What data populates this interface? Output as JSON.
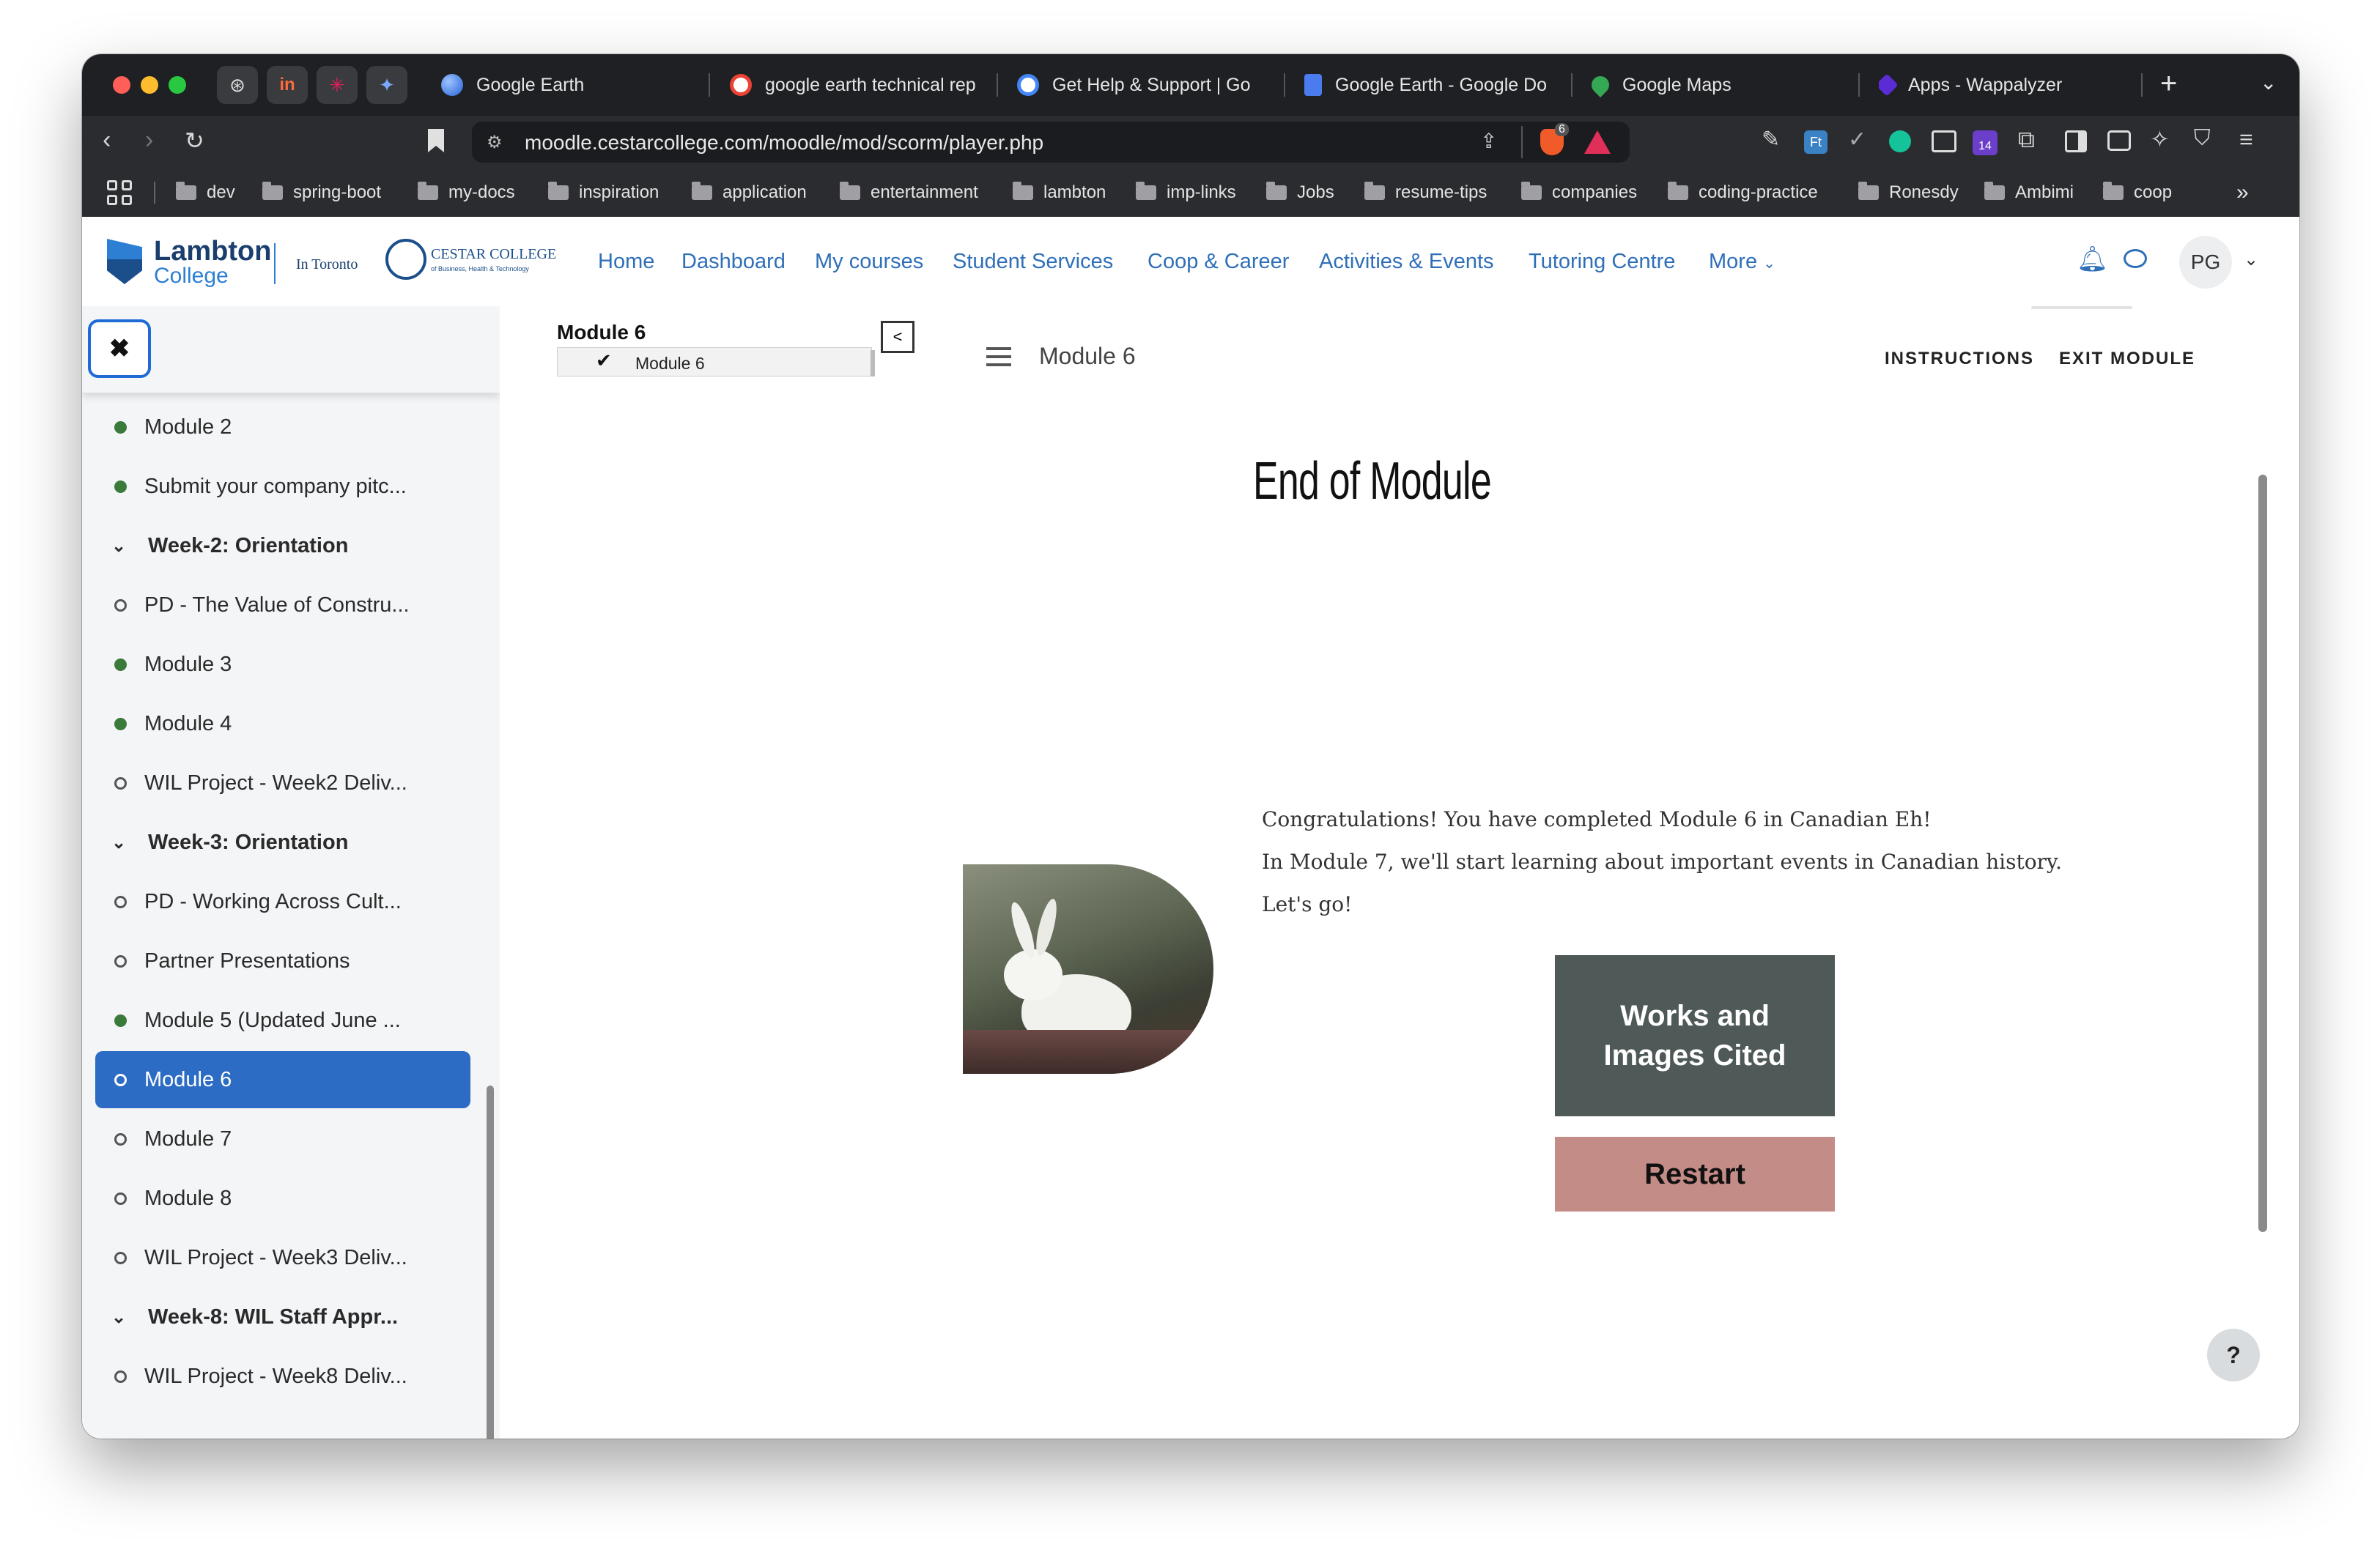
{
  "browser": {
    "pinned_tabs": [
      "openai-icon",
      "invision-icon",
      "slack-icon",
      "gemini-icon"
    ],
    "tabs": [
      {
        "label": "Google Earth",
        "fav_color": "#3b78e7"
      },
      {
        "label": "google earth technical rep",
        "fav_color": "#ffffff"
      },
      {
        "label": "Get Help & Support  |  Go",
        "fav_color": "#ffffff"
      },
      {
        "label": "Google Earth - Google Do",
        "fav_color": "#4a7cf0"
      },
      {
        "label": "Google Maps",
        "fav_color": "#34a853"
      },
      {
        "label": "Apps - Wappalyzer",
        "fav_color": "#5b2bd6"
      }
    ],
    "new_tab_label": "+",
    "url": "moodle.cestarcollege.com/moodle/mod/scorm/player.php",
    "brave_badge": "6",
    "extension_badge": "14",
    "bookmarks": [
      "dev",
      "spring-boot",
      "my-docs",
      "inspiration",
      "application",
      "entertainment",
      "lambton",
      "imp-links",
      "Jobs",
      "resume-tips",
      "companies",
      "coding-practice",
      "Ronesdy",
      "Ambimi",
      "coop"
    ],
    "bookmarks_more": "»"
  },
  "site": {
    "logo_name": "Lambton",
    "logo_sub": "College",
    "logo_location": "In Toronto",
    "partner_name": "CESTAR COLLEGE",
    "partner_sub": "of Business, Health & Technology",
    "nav": [
      "Home",
      "Dashboard",
      "My courses",
      "Student Services",
      "Coop & Career",
      "Activities & Events",
      "Tutoring Centre",
      "More"
    ],
    "user_initials": "PG"
  },
  "drawer": {
    "close_label": "✖",
    "items": [
      {
        "label": "Module 2",
        "kind": "done"
      },
      {
        "label": "Submit your company pitc...",
        "kind": "done"
      },
      {
        "label": "Week-2: Orientation",
        "kind": "section"
      },
      {
        "label": "PD - The Value of Constru...",
        "kind": "todo"
      },
      {
        "label": "Module 3",
        "kind": "done"
      },
      {
        "label": "Module 4",
        "kind": "done"
      },
      {
        "label": "WIL Project - Week2 Deliv...",
        "kind": "todo"
      },
      {
        "label": "Week-3: Orientation",
        "kind": "section"
      },
      {
        "label": "PD - Working Across Cult...",
        "kind": "todo"
      },
      {
        "label": "Partner Presentations",
        "kind": "todo"
      },
      {
        "label": "Module 5 (Updated June ...",
        "kind": "done"
      },
      {
        "label": "Module 6",
        "kind": "active"
      },
      {
        "label": "Module 7",
        "kind": "todo"
      },
      {
        "label": "Module 8",
        "kind": "todo"
      },
      {
        "label": "WIL Project - Week3 Deliv...",
        "kind": "todo"
      },
      {
        "label": "Week-8: WIL Staff Appr...",
        "kind": "section"
      },
      {
        "label": "WIL Project - Week8 Deliv...",
        "kind": "todo"
      }
    ]
  },
  "scorm": {
    "toc_title": "Module 6",
    "toc_item": "Module 6",
    "toc_toggle": "<",
    "header_title": "Module 6",
    "instructions": "INSTRUCTIONS",
    "exit": "EXIT MODULE"
  },
  "lesson": {
    "title": "End of Module",
    "line1": "Congratulations! You have completed Module 6 in Canadian Eh!",
    "line2": "In Module 7, we'll start learning about important events in Canadian history.",
    "line3": "Let's go!",
    "works_btn": "Works and Images Cited",
    "restart_btn": "Restart",
    "works_color": "#4f5a58",
    "restart_color": "#c48c86"
  },
  "help_label": "?"
}
